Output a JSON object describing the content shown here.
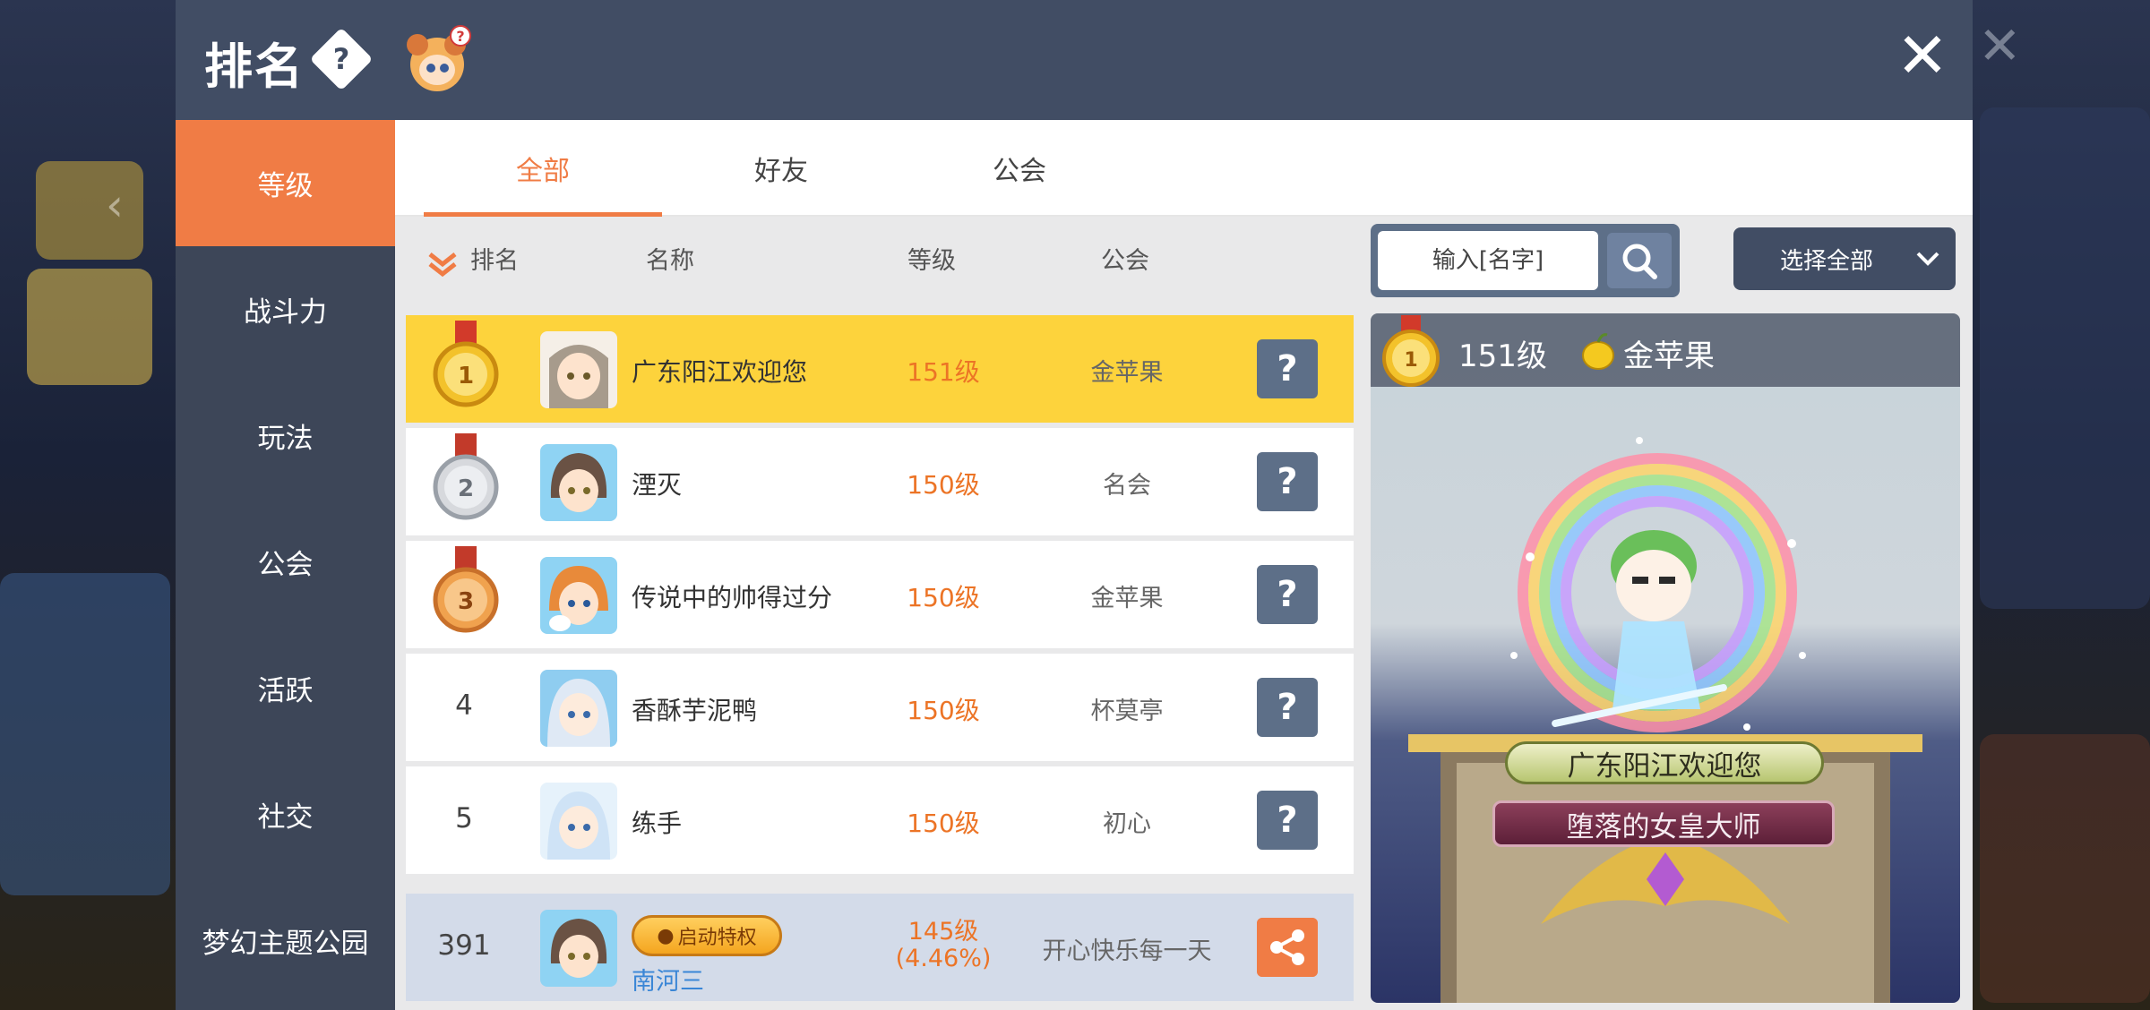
{
  "header": {
    "title": "排名"
  },
  "sidebar": {
    "items": [
      {
        "label": "等级",
        "active": true
      },
      {
        "label": "战斗力"
      },
      {
        "label": "玩法"
      },
      {
        "label": "公会"
      },
      {
        "label": "活跃"
      },
      {
        "label": "社交"
      },
      {
        "label": "梦幻主题公园"
      }
    ]
  },
  "tabs": [
    {
      "label": "全部",
      "active": true
    },
    {
      "label": "好友"
    },
    {
      "label": "公会"
    }
  ],
  "columns": {
    "rank": "排名",
    "name": "名称",
    "level": "等级",
    "guild": "公会"
  },
  "search": {
    "placeholder": "输入[名字]",
    "select_label": "选择全部"
  },
  "rows": [
    {
      "rank": "1",
      "name": "广东阳江欢迎您",
      "level": "151级",
      "guild": "金苹果"
    },
    {
      "rank": "2",
      "name": "湮灭",
      "level": "150级",
      "guild": "名会"
    },
    {
      "rank": "3",
      "name": "传说中的帅得过分",
      "level": "150级",
      "guild": "金苹果"
    },
    {
      "rank": "4",
      "name": "香酥芋泥鸭",
      "level": "150级",
      "guild": "杯莫亭"
    },
    {
      "rank": "5",
      "name": "练手",
      "level": "150级",
      "guild": "初心"
    }
  ],
  "me": {
    "rank": "391",
    "badge": "启动特权",
    "name": "南河三",
    "level": "145级",
    "percent": "(4.46%)",
    "guild": "开心快乐每一天"
  },
  "preview": {
    "level": "151级",
    "guild": "金苹果",
    "character_name": "广东阳江欢迎您",
    "character_title": "堕落的女皇大师"
  },
  "colors": {
    "accent": "#f07c45",
    "header": "#414d64",
    "sidebar": "#3d4658",
    "first_row": "#fdd33c",
    "level_text": "#ec7426"
  },
  "icons": {
    "help": "diamond-question-icon",
    "close": "close-icon",
    "search": "search-icon",
    "share": "share-icon",
    "sort": "chevron-down-icon"
  }
}
